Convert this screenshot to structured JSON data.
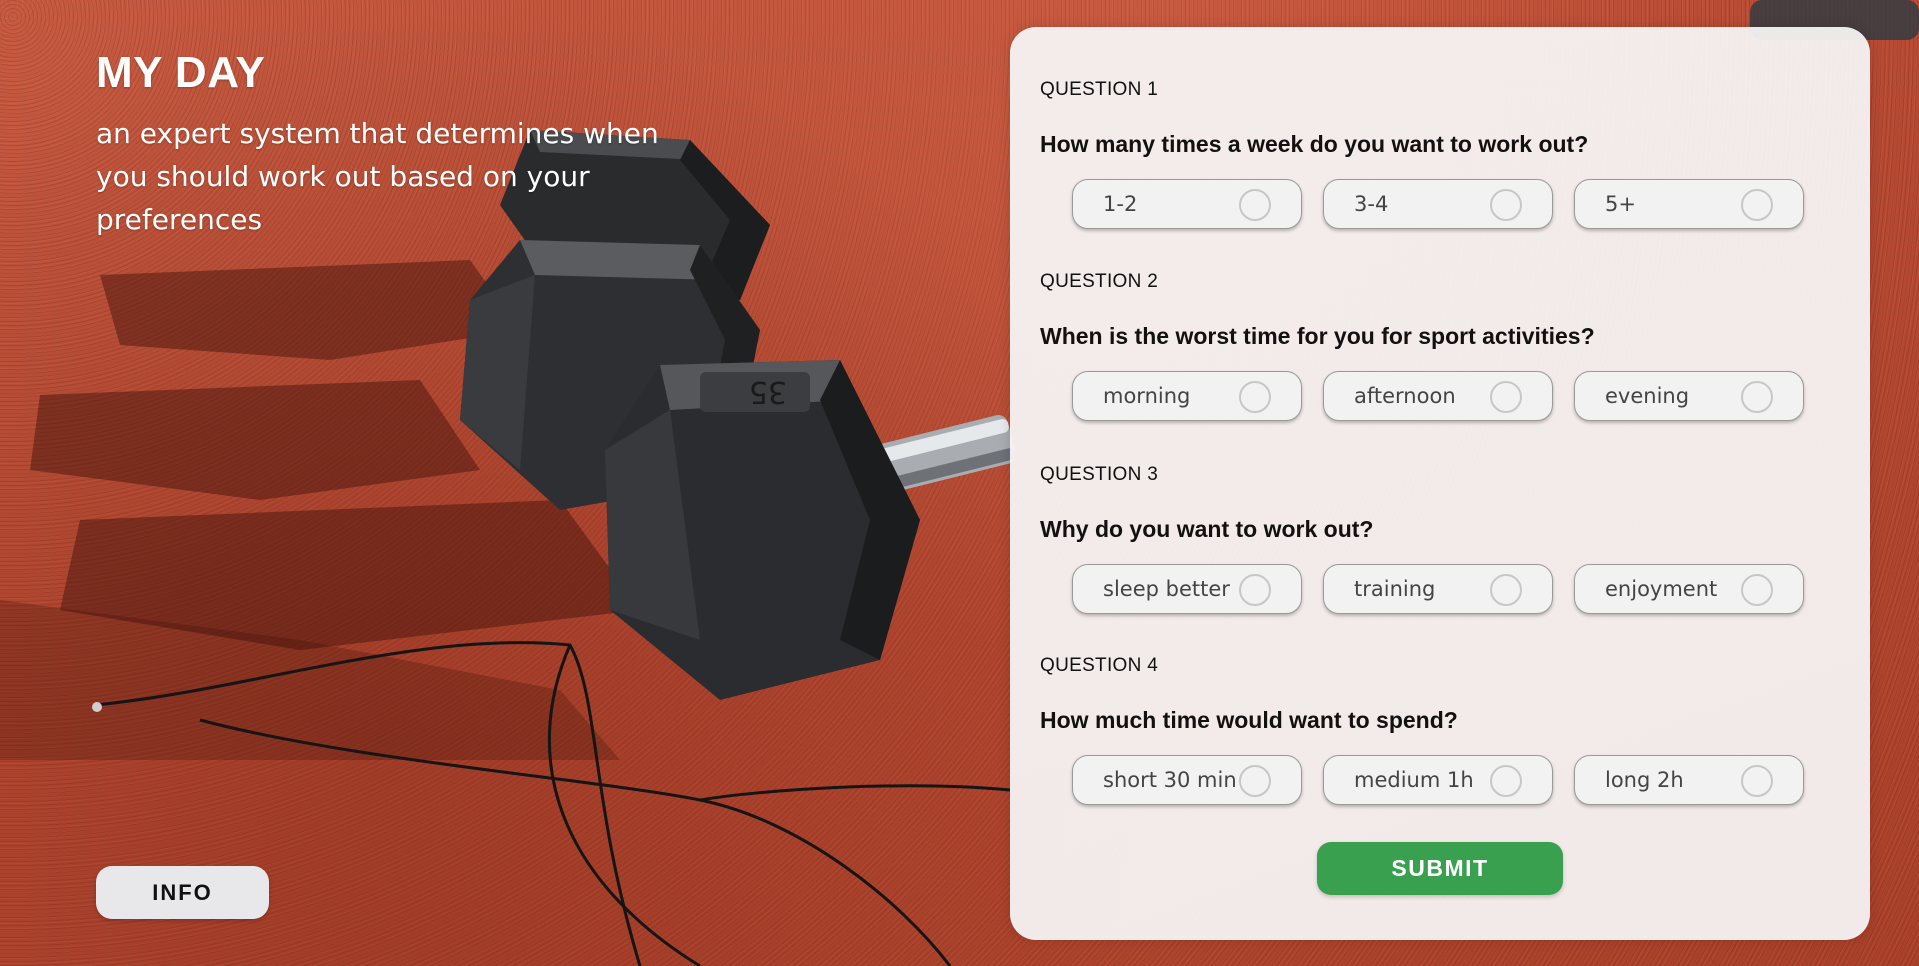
{
  "header": {
    "title": "MY DAY",
    "subtitle": "an expert system that determines when you should work out based on your preferences"
  },
  "info_button": {
    "label": "INFO"
  },
  "questions": [
    {
      "number_label": "QUESTION 1",
      "text": "How many times a week do you want to work out?",
      "options": [
        {
          "label": "1-2"
        },
        {
          "label": "3-4"
        },
        {
          "label": "5+"
        }
      ]
    },
    {
      "number_label": "QUESTION 2",
      "text": "When is the worst time for you for sport activities?",
      "options": [
        {
          "label": "morning"
        },
        {
          "label": "afternoon"
        },
        {
          "label": "evening"
        }
      ]
    },
    {
      "number_label": "QUESTION 3",
      "text": "Why do you want to work out?",
      "options": [
        {
          "label": "sleep better"
        },
        {
          "label": "training"
        },
        {
          "label": "enjoyment"
        }
      ]
    },
    {
      "number_label": "QUESTION 4",
      "text": "How much time would want to spend?",
      "options": [
        {
          "label": "short 30 min"
        },
        {
          "label": "medium 1h"
        },
        {
          "label": "long 2h"
        }
      ]
    }
  ],
  "submit_button": {
    "label": "SUBMIT"
  },
  "colors": {
    "submit": "#39a04f",
    "track": "#b8503a",
    "card": "#f8f8f8"
  }
}
